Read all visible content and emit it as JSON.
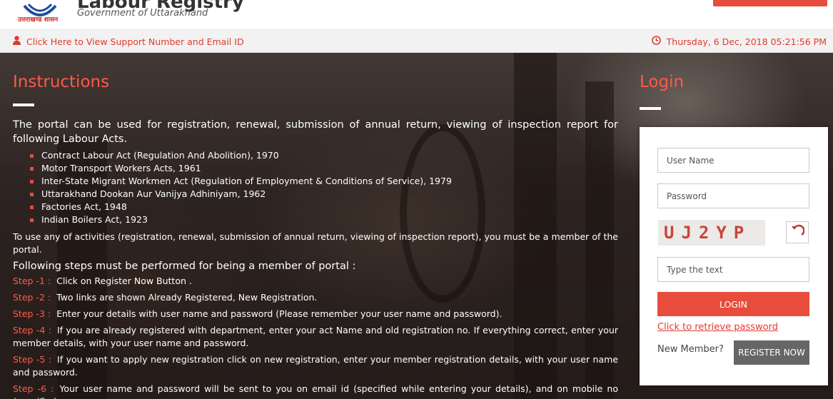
{
  "header": {
    "title": "Labour Registry",
    "subtitle": "Government of Uttarakhand",
    "logo_text": "उत्तराखण्ड शासन"
  },
  "support_bar": {
    "support_link": "Click Here to View Support Number and Email ID",
    "datetime": "Thursday, 6 Dec, 2018 05:21:56 PM"
  },
  "instructions": {
    "title": "Instructions",
    "intro": "The portal can be used for registration, renewal, submission of annual return, viewing of inspection report for following Labour Acts.",
    "acts": [
      "Contract Labour Act (Regulation And Abolition), 1970",
      "Motor Transport Workers Acts, 1961",
      "Inter-State Migrant Workmen Act (Regulation of Employment & Conditions of Service), 1979",
      "Uttarakhand Dookan Aur Vanijya Adhiniyam, 1962",
      "Factories Act, 1948",
      "Indian Boilers Act, 1923"
    ],
    "membership_note": "To use any of activities (registration, renewal, submission of annual return, viewing of inspection report), you must be a member of the portal.",
    "steps_heading": "Following steps must be performed for being a member of portal :",
    "steps": [
      {
        "label": "Step -1 :",
        "text": "Click on Register Now Button ."
      },
      {
        "label": "Step -2 :",
        "text": "Two links are shown Already Registered, New Registration."
      },
      {
        "label": "Step -3 :",
        "text": "Enter your details with user name and password (Please remember your user name and password)."
      },
      {
        "label": "Step -4 :",
        "text": "If you are already registered with department, enter your act Name and old registration no. If everything correct, enter your member details, with your user name and password."
      },
      {
        "label": "Step -5 :",
        "text": "If you want to apply new registration click on new registration, enter your member registration details, with your user name and password."
      },
      {
        "label": "Step -6 :",
        "text": "Your user name and password will be sent to you on email id (specified while entering your details), and on mobile no (specified"
      }
    ]
  },
  "login": {
    "title": "Login",
    "username_placeholder": "User Name",
    "password_placeholder": "Password",
    "captcha_text": "UJ2YP",
    "captcha_placeholder": "Type the text",
    "login_button": "LOGIN",
    "retrieve_link": "Click to retrieve password",
    "new_member_label": "New Member?",
    "register_button": "REGISTER NOW"
  },
  "colors": {
    "accent": "#e74c3c",
    "link": "#e03a2e"
  }
}
